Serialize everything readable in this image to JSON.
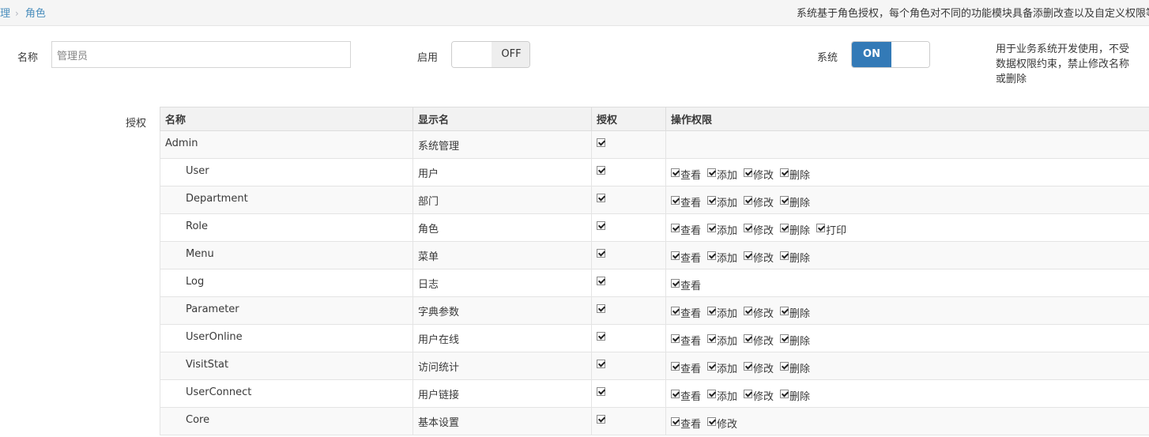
{
  "breadcrumb": {
    "parent": "理",
    "current": "角色"
  },
  "description": "系统基于角色授权，每个角色对不同的功能模块具备添删改查以及自定义权限等",
  "form": {
    "name_label": "名称",
    "name_value": "管理员",
    "enable_label": "启用",
    "enable_state": "OFF",
    "system_label": "系统",
    "system_state": "ON",
    "system_help": "用于业务系统开发使用，不受数据权限约束，禁止修改名称或删除",
    "auth_label": "授权"
  },
  "table": {
    "headers": [
      "名称",
      "显示名",
      "授权",
      "操作权限"
    ],
    "rows": [
      {
        "name": "Admin",
        "display": "系统管理",
        "checked": true,
        "ops": [],
        "level": 0
      },
      {
        "name": "User",
        "display": "用户",
        "checked": true,
        "ops": [
          "查看",
          "添加",
          "修改",
          "删除"
        ],
        "level": 1
      },
      {
        "name": "Department",
        "display": "部门",
        "checked": true,
        "ops": [
          "查看",
          "添加",
          "修改",
          "删除"
        ],
        "level": 1
      },
      {
        "name": "Role",
        "display": "角色",
        "checked": true,
        "ops": [
          "查看",
          "添加",
          "修改",
          "删除",
          "打印"
        ],
        "level": 1
      },
      {
        "name": "Menu",
        "display": "菜单",
        "checked": true,
        "ops": [
          "查看",
          "添加",
          "修改",
          "删除"
        ],
        "level": 1
      },
      {
        "name": "Log",
        "display": "日志",
        "checked": true,
        "ops": [
          "查看"
        ],
        "level": 1
      },
      {
        "name": "Parameter",
        "display": "字典参数",
        "checked": true,
        "ops": [
          "查看",
          "添加",
          "修改",
          "删除"
        ],
        "level": 1
      },
      {
        "name": "UserOnline",
        "display": "用户在线",
        "checked": true,
        "ops": [
          "查看",
          "添加",
          "修改",
          "删除"
        ],
        "level": 1
      },
      {
        "name": "VisitStat",
        "display": "访问统计",
        "checked": true,
        "ops": [
          "查看",
          "添加",
          "修改",
          "删除"
        ],
        "level": 1
      },
      {
        "name": "UserConnect",
        "display": "用户链接",
        "checked": true,
        "ops": [
          "查看",
          "添加",
          "修改",
          "删除"
        ],
        "level": 1
      },
      {
        "name": "Core",
        "display": "基本设置",
        "checked": true,
        "ops": [
          "查看",
          "修改"
        ],
        "level": 1
      }
    ]
  },
  "colors": {
    "link": "#4c8fbd",
    "switch_on": "#337ab7"
  }
}
